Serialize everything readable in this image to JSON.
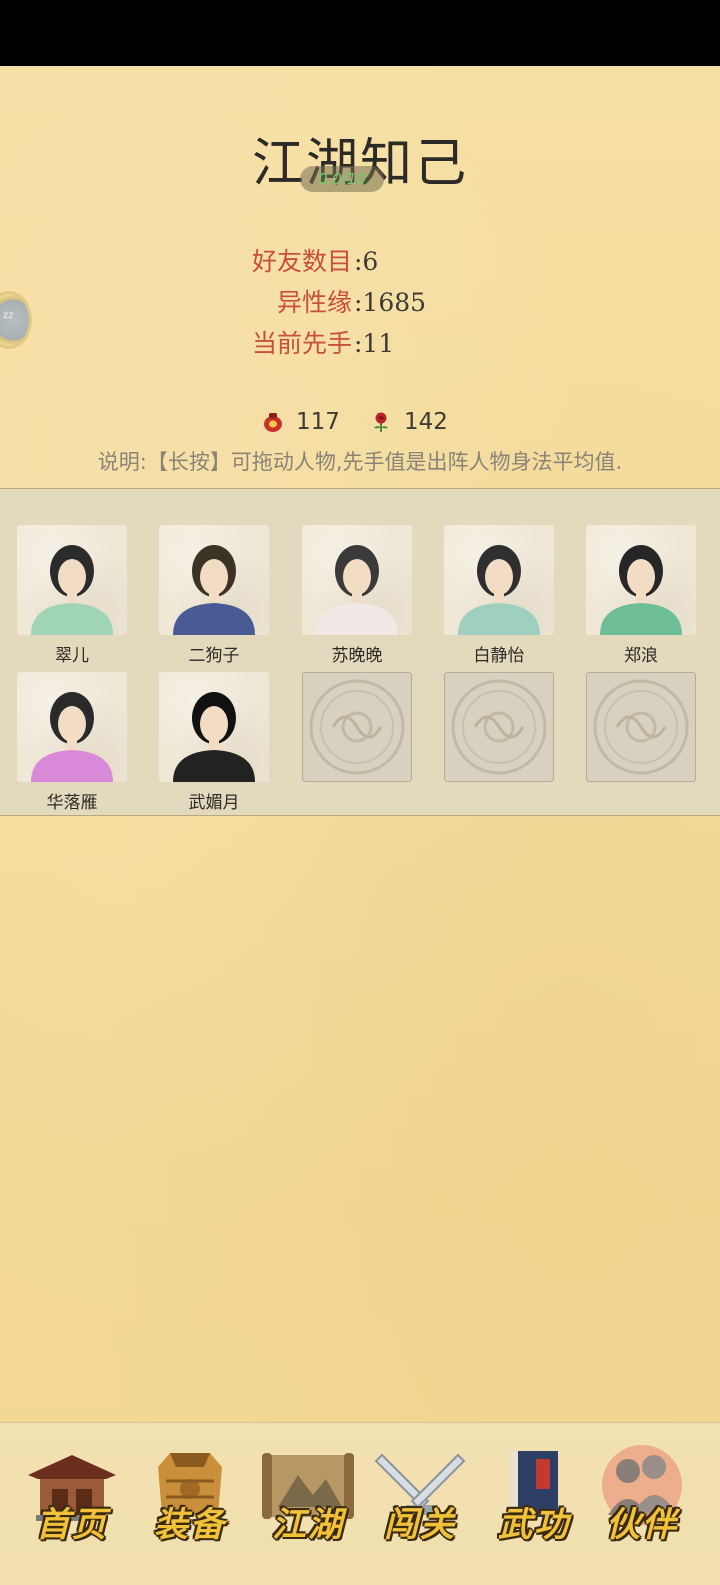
{
  "title": "江湖知己",
  "title_badge": "0.0/10",
  "side_orb_text": "zz",
  "stats": [
    {
      "label": "好友数目",
      "value": ":6"
    },
    {
      "label": "异性缘",
      "value": ":1685"
    },
    {
      "label": "当前先手",
      "value": ":11"
    }
  ],
  "currency": [
    {
      "icon": "wine-jar-icon",
      "value": "117",
      "color": "#c8302a"
    },
    {
      "icon": "rose-icon",
      "value": "142",
      "color": "#b8242a"
    }
  ],
  "hint": "说明:【长按】可拖动人物,先手值是出阵人物身法平均值.",
  "companions": [
    {
      "name": "翠儿",
      "robe": "#9fd4b6",
      "hair": "#2b2b2b"
    },
    {
      "name": "二狗子",
      "robe": "#4a5a94",
      "hair": "#3a3326"
    },
    {
      "name": "苏晚晚",
      "robe": "#f0e9e6",
      "hair": "#3a3a3a"
    },
    {
      "name": "白静怡",
      "robe": "#9fd0bf",
      "hair": "#2f2f2f"
    },
    {
      "name": "郑浪",
      "robe": "#6dbd96",
      "hair": "#262626"
    },
    {
      "name": "华落雁",
      "robe": "#d88ad8",
      "hair": "#2a2a2a"
    },
    {
      "name": "武媚月",
      "robe": "#222222",
      "hair": "#111111"
    }
  ],
  "empty_slots": 3,
  "nav": [
    {
      "label": "首页",
      "icon": "house-icon"
    },
    {
      "label": "装备",
      "icon": "armor-icon"
    },
    {
      "label": "江湖",
      "icon": "scroll-map-icon"
    },
    {
      "label": "闯关",
      "icon": "crossed-swords-icon"
    },
    {
      "label": "武功",
      "icon": "book-icon"
    },
    {
      "label": "伙伴",
      "icon": "companions-icon",
      "active": true
    }
  ]
}
